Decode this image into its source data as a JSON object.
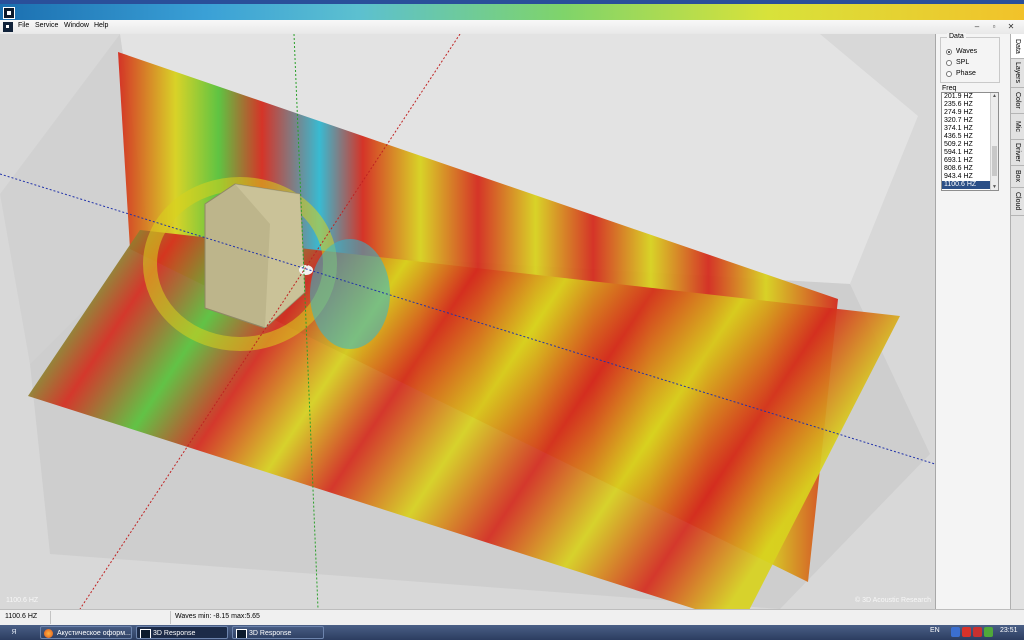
{
  "window": {
    "minimize": "–",
    "restore": "▫",
    "close": "✕"
  },
  "menu": [
    "File",
    "Service",
    "Window",
    "Help"
  ],
  "viewport": {
    "freq_badge": "1100.6 HZ",
    "copyright": "© 3D Acoustic Research"
  },
  "panel": {
    "data_group_title": "Data",
    "radios": [
      {
        "label": "Waves",
        "checked": true
      },
      {
        "label": "SPL",
        "checked": false
      },
      {
        "label": "Phase",
        "checked": false
      }
    ],
    "freq_label": "Freq",
    "freq_list": [
      "201.9 HZ",
      "235.6 HZ",
      "274.9 HZ",
      "320.7 HZ",
      "374.1 HZ",
      "436.5 HZ",
      "509.2 HZ",
      "594.1 HZ",
      "693.1 HZ",
      "808.6 HZ",
      "943.4 HZ",
      "1100.6 HZ"
    ],
    "freq_selected": "1100.6 HZ"
  },
  "tabs": [
    "Data",
    "Layers",
    "Color",
    "Mic",
    "Driver",
    "Box",
    "Cloud"
  ],
  "status": {
    "freq": "1100.6 HZ",
    "waves": "Waves min: -8.15 max:5.65"
  },
  "taskbar": {
    "start": "Я",
    "tasks": [
      "Акустическое оформ...",
      "3D Response",
      "3D Response"
    ],
    "lang": "EN",
    "time": "23:51"
  },
  "colors": {
    "red": "#d42b1e",
    "yellow": "#d8d21e",
    "green": "#58c23a",
    "cyan": "#30b8d0",
    "panel": "#f4f4f4"
  }
}
